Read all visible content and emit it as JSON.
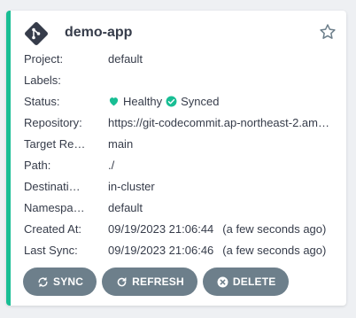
{
  "app": {
    "name": "demo-app",
    "icon": "git-branch-diamond-icon",
    "favorite_icon": "star-outline-icon"
  },
  "fields": {
    "project": {
      "label": "Project:",
      "value": "default"
    },
    "labels": {
      "label": "Labels:",
      "value": ""
    },
    "status": {
      "label": "Status:",
      "health": "Healthy",
      "sync": "Synced"
    },
    "repository": {
      "label": "Repository:",
      "value": "https://git-codecommit.ap-northeast-2.am…"
    },
    "target_revision": {
      "label": "Target Re…",
      "value": "main"
    },
    "path": {
      "label": "Path:",
      "value": "./"
    },
    "destination": {
      "label": "Destinati…",
      "value": "in-cluster"
    },
    "namespace": {
      "label": "Namespa…",
      "value": "default"
    },
    "created_at": {
      "label": "Created At:",
      "value": "09/19/2023 21:06:44",
      "ago": "(a few seconds ago)"
    },
    "last_sync": {
      "label": "Last Sync:",
      "value": "09/19/2023 21:06:46",
      "ago": "(a few seconds ago)"
    }
  },
  "actions": {
    "sync": "SYNC",
    "refresh": "REFRESH",
    "delete": "DELETE"
  },
  "colors": {
    "accent": "#18be94",
    "button": "#6d7f8b",
    "text": "#363c4a"
  }
}
